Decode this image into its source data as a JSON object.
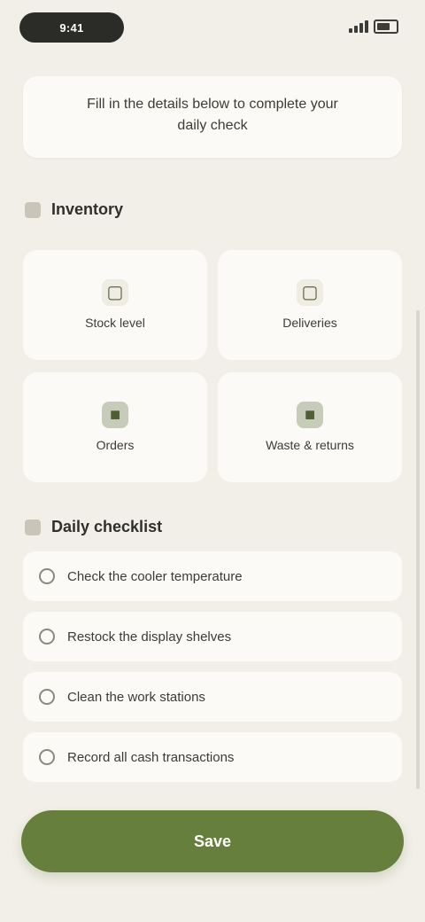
{
  "status_bar": {
    "time": "9:41"
  },
  "notice": {
    "text": "Fill in the details below to complete your daily check"
  },
  "inventory": {
    "title": "Inventory",
    "items": [
      {
        "icon": "box-icon",
        "label": "Stock level"
      },
      {
        "icon": "truck-icon",
        "label": "Deliveries"
      },
      {
        "icon": "cart-icon",
        "label": "Orders"
      },
      {
        "icon": "leaf-icon",
        "label": "Waste & returns"
      }
    ]
  },
  "checklist": {
    "title": "Daily checklist",
    "items": [
      {
        "label": "Check the cooler temperature"
      },
      {
        "label": "Restock the display shelves"
      },
      {
        "label": "Clean the work stations"
      },
      {
        "label": "Record all cash transactions"
      }
    ]
  },
  "primary_button": {
    "label": "Save"
  },
  "colors": {
    "background": "#f1efe7",
    "card": "#fbfaf6",
    "accent": "#667f3d"
  }
}
